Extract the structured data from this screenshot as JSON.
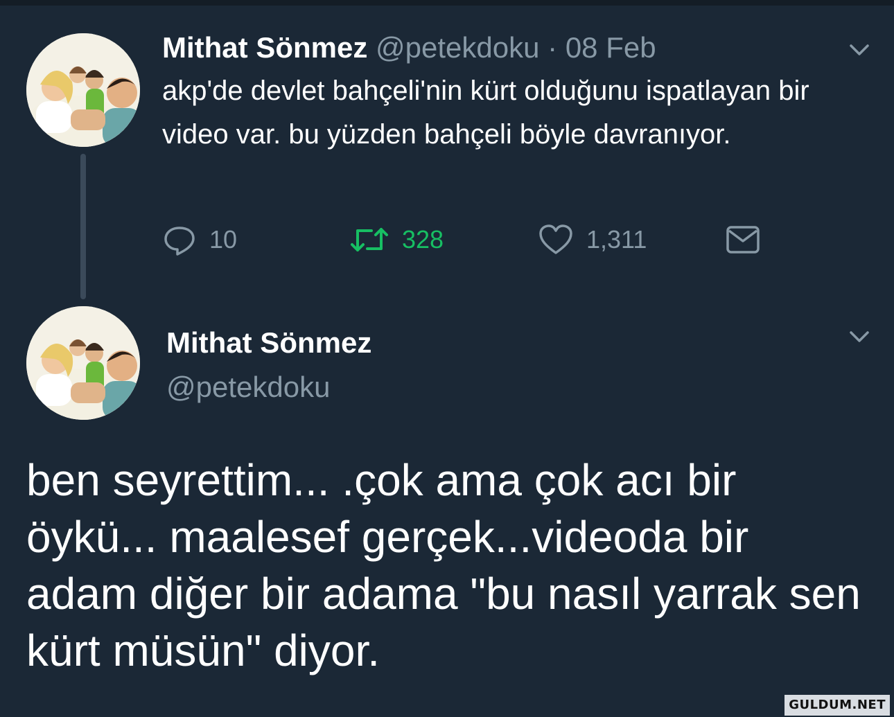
{
  "tweet1": {
    "name": "Mithat Sönmez",
    "handle": "@petekdoku",
    "separator": "·",
    "date": "08 Feb",
    "text": "akp'de devlet bahçeli'nin kürt olduğunu ispatlayan bir video var. bu yüzden bahçeli böyle davranıyor.",
    "actions": {
      "reply_count": "10",
      "retweet_count": "328",
      "like_count": "1,311"
    }
  },
  "tweet2": {
    "name": "Mithat Sönmez",
    "handle": "@petekdoku",
    "text": "ben seyrettim... .çok ama çok acı bir öykü... maalesef gerçek...videoda bir adam diğer bir adama \"bu nasıl yarrak sen kürt müsün\" diyor."
  },
  "icons": {
    "reply": "reply-icon",
    "retweet": "retweet-icon",
    "like": "heart-icon",
    "message": "envelope-icon",
    "menu": "chevron-down-icon"
  },
  "colors": {
    "background": "#1b2836",
    "muted": "#8899a6",
    "retweet_active": "#17bf63"
  },
  "watermark": "GULDUM.NET"
}
